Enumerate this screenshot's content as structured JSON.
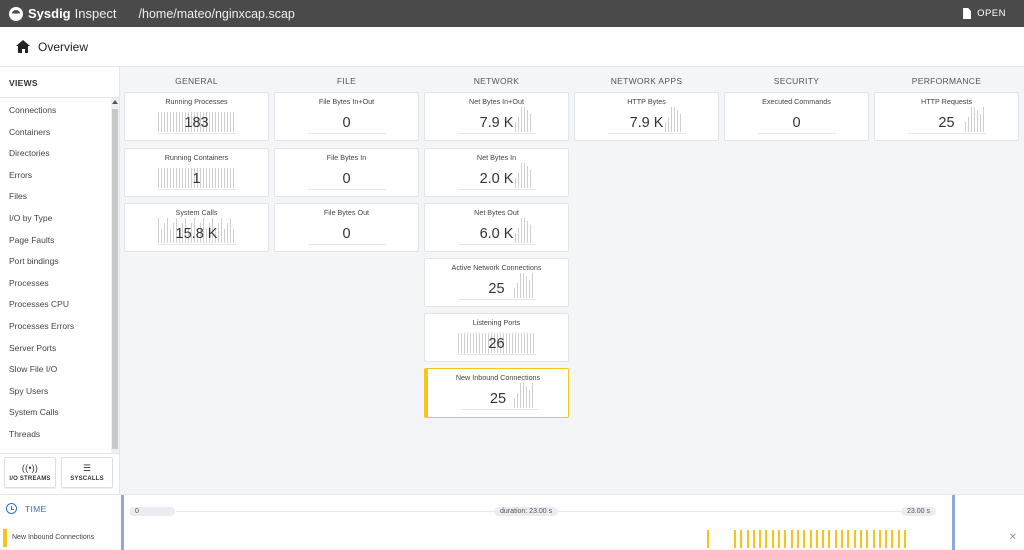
{
  "app": {
    "brand": "Sysdig",
    "product": "Inspect",
    "path": "/home/mateo/nginxcap.scap",
    "open_label": "OPEN"
  },
  "header": {
    "title": "Overview"
  },
  "sidebar": {
    "title": "VIEWS",
    "items": [
      "Connections",
      "Containers",
      "Directories",
      "Errors",
      "Files",
      "I/O by Type",
      "Page Faults",
      "Port bindings",
      "Processes",
      "Processes CPU",
      "Processes Errors",
      "Server Ports",
      "Slow File I/O",
      "Spy Users",
      "System Calls",
      "Threads"
    ],
    "buttons": {
      "io_streams": "I/O STREAMS",
      "syscalls": "SYSCALLS"
    }
  },
  "columns": [
    {
      "title": "GENERAL",
      "tiles": [
        {
          "title": "Running Processes",
          "value": "183"
        },
        {
          "title": "Running Containers",
          "value": "1"
        },
        {
          "title": "System Calls",
          "value": "15.8 K"
        }
      ]
    },
    {
      "title": "FILE",
      "tiles": [
        {
          "title": "File Bytes In+Out",
          "value": "0"
        },
        {
          "title": "File Bytes In",
          "value": "0"
        },
        {
          "title": "File Bytes Out",
          "value": "0"
        }
      ]
    },
    {
      "title": "NETWORK",
      "tiles": [
        {
          "title": "Net Bytes In+Out",
          "value": "7.9 K"
        },
        {
          "title": "Net Bytes In",
          "value": "2.0 K"
        },
        {
          "title": "Net Bytes Out",
          "value": "6.0 K"
        },
        {
          "title": "Active Network Connections",
          "value": "25"
        },
        {
          "title": "Listening Ports",
          "value": "26"
        },
        {
          "title": "New Inbound Connections",
          "value": "25",
          "selected": true
        }
      ]
    },
    {
      "title": "NETWORK APPS",
      "tiles": [
        {
          "title": "HTTP Bytes",
          "value": "7.9 K"
        }
      ]
    },
    {
      "title": "SECURITY",
      "tiles": [
        {
          "title": "Executed Commands",
          "value": "0"
        }
      ]
    },
    {
      "title": "PERFORMANCE",
      "tiles": [
        {
          "title": "HTTP Requests",
          "value": "25"
        }
      ]
    }
  ],
  "timeline": {
    "label": "TIME",
    "start": "0",
    "duration": "duration: 23.00 s",
    "end": "23.00 s",
    "track_label": "New Inbound Connections",
    "accent": "#f5c518",
    "handle_color": "#8da9d6"
  },
  "colors": {
    "topbar": "#4a4a4a",
    "accent": "#f5c518",
    "time_blue": "#3a6fb4"
  }
}
